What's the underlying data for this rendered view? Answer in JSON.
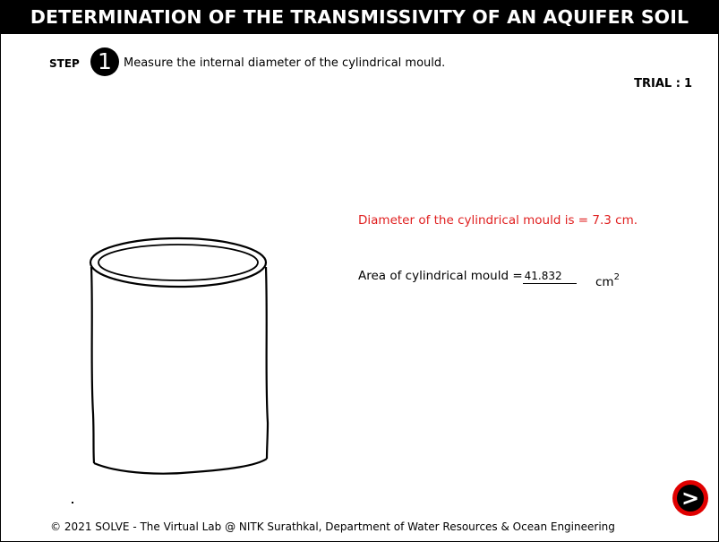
{
  "title": "DETERMINATION OF THE TRANSMISSIVITY OF AN AQUIFER SOIL",
  "step": {
    "label": "STEP",
    "number": "1",
    "instruction": "Measure the internal diameter of the cylindrical mould."
  },
  "trial": {
    "label": "TRIAL :",
    "number": "1"
  },
  "results": {
    "diameter_text": "Diameter of the cylindrical mould is = 7.3 cm.",
    "area_label": "Area of cylindrical mould =",
    "area_value": "41.832",
    "area_unit": "cm",
    "area_unit_exp": "2"
  },
  "next_button": {
    "label": ">"
  },
  "footer": "© 2021 SOLVE - The Virtual Lab @ NITK Surathkal, Department of Water Resources & Ocean Engineering",
  "colors": {
    "title_bg": "#000000",
    "highlight_text": "#e02020",
    "next_button": "#e00000"
  }
}
